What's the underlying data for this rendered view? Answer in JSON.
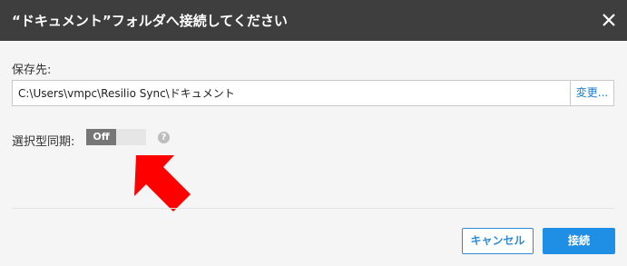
{
  "dialog": {
    "title": "“ドキュメント”フォルダへ接続してください",
    "close_icon": "close-icon"
  },
  "location": {
    "label": "保存先:",
    "value": "C:\\Users\\vmpc\\Resilio Sync\\ドキュメント",
    "change_label": "変更..."
  },
  "selective_sync": {
    "label": "選択型同期:",
    "state": "Off",
    "help_icon_label": "?"
  },
  "annotation": {
    "arrow_color": "#ff0000"
  },
  "buttons": {
    "cancel_label": "キャンセル",
    "connect_label": "接続"
  },
  "colors": {
    "titlebar": "#3e3e3e",
    "accent": "#1f8fe6"
  }
}
